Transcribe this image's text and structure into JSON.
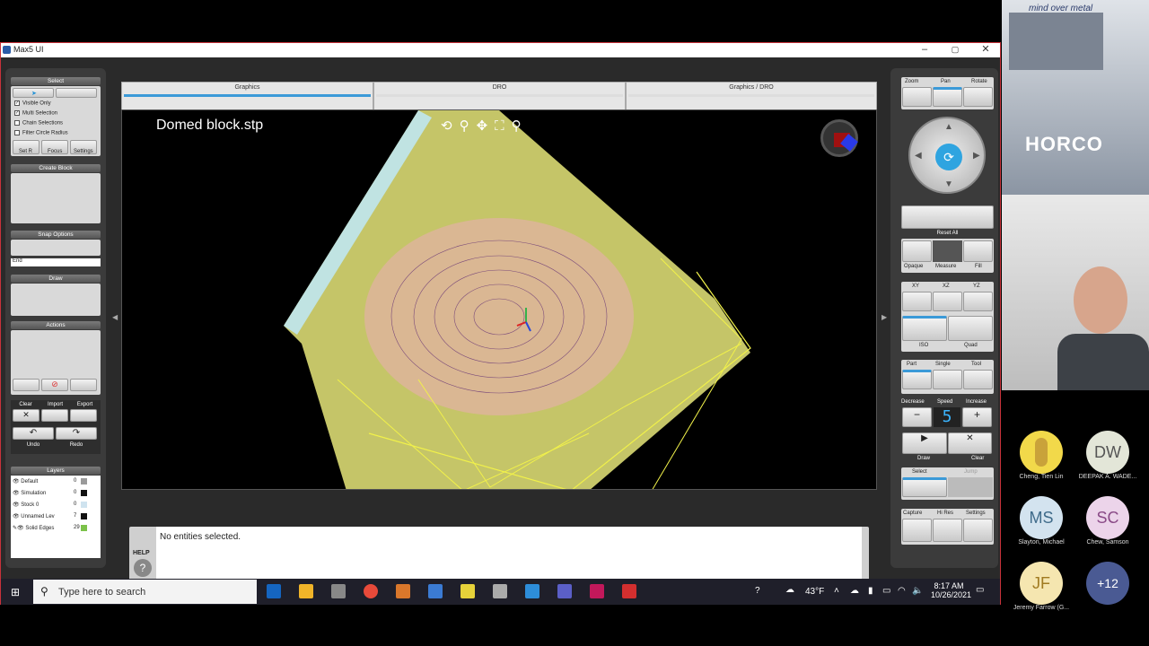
{
  "window": {
    "title": "Max5 UI",
    "minimize": "–",
    "maximize": "▢",
    "close": "✕"
  },
  "tabs": [
    "Graphics",
    "DRO",
    "Graphics / DRO"
  ],
  "viewport": {
    "filename": "Domed block.stp"
  },
  "left_panel": {
    "select": {
      "header": "Select",
      "options": [
        {
          "label": "Visible Only",
          "checked": true
        },
        {
          "label": "Multi Selection",
          "checked": true
        },
        {
          "label": "Chain Selections",
          "checked": false
        },
        {
          "label": "Filter Circle Radius",
          "checked": false
        }
      ],
      "buttons": [
        "Set R",
        "Focus",
        "Settings"
      ]
    },
    "create_block": {
      "header": "Create Block"
    },
    "snap": {
      "header": "Snap Options",
      "value": "End"
    },
    "draw": {
      "header": "Draw"
    },
    "actions": {
      "header": "Actions"
    },
    "file": {
      "labels": [
        "Clear",
        "Import",
        "Export"
      ],
      "undo": "Undo",
      "redo": "Redo"
    },
    "layers": {
      "header": "Layers",
      "items": [
        {
          "name": "Default",
          "count": "0",
          "color": "#9a9a9a"
        },
        {
          "name": "Simulation",
          "count": "0",
          "color": "#111111"
        },
        {
          "name": "Stock 0",
          "count": "0",
          "color": "#cfe3ef"
        },
        {
          "name": "Unnamed Lev",
          "count": "7",
          "color": "#111111"
        },
        {
          "name": "Solid Edges",
          "count": "29",
          "color": "#7cc24a"
        }
      ]
    }
  },
  "right_panel": {
    "view": [
      "Zoom",
      "Pan",
      "Rotate"
    ],
    "reset_all": "Reset All",
    "display": [
      "Opaque",
      "Measure",
      "Fill"
    ],
    "planes": [
      "XY",
      "XZ",
      "YZ"
    ],
    "iso": [
      "ISO",
      "Quad"
    ],
    "part": [
      "Part",
      "Single",
      "Tool"
    ],
    "speed": {
      "labels": [
        "Decrease",
        "Speed",
        "Increase"
      ],
      "value": "5",
      "minus": "−",
      "plus": "+"
    },
    "draw_clear": [
      "Draw",
      "Clear"
    ],
    "select": [
      "Select",
      "Jump"
    ],
    "capture": [
      "Capture",
      "Hi Res",
      "Settings"
    ]
  },
  "console": {
    "help": "HELP",
    "message": "No entities selected."
  },
  "taskbar": {
    "search_placeholder": "Type here to search",
    "temp": "43°F",
    "time": "8:17 AM",
    "date": "10/26/2021"
  },
  "meeting": {
    "banner": "mind over metal",
    "banner_brand": "HORCO",
    "participants": [
      {
        "initials": "",
        "name": "Cheng, Tien Lin",
        "color": "#f2d94a"
      },
      {
        "initials": "DW",
        "name": "DEEPAK A. WADE...",
        "color": "#e3e6d8"
      },
      {
        "initials": "MS",
        "name": "Slayton, Michael",
        "color": "#d3e3ef"
      },
      {
        "initials": "SC",
        "name": "Chew, Samson",
        "color": "#ecd4ea"
      },
      {
        "initials": "JF",
        "name": "Jeremy Farrow (G...",
        "color": "#f5e6b0"
      },
      {
        "initials": "+12",
        "name": "",
        "color": "#4a5a93"
      }
    ]
  }
}
